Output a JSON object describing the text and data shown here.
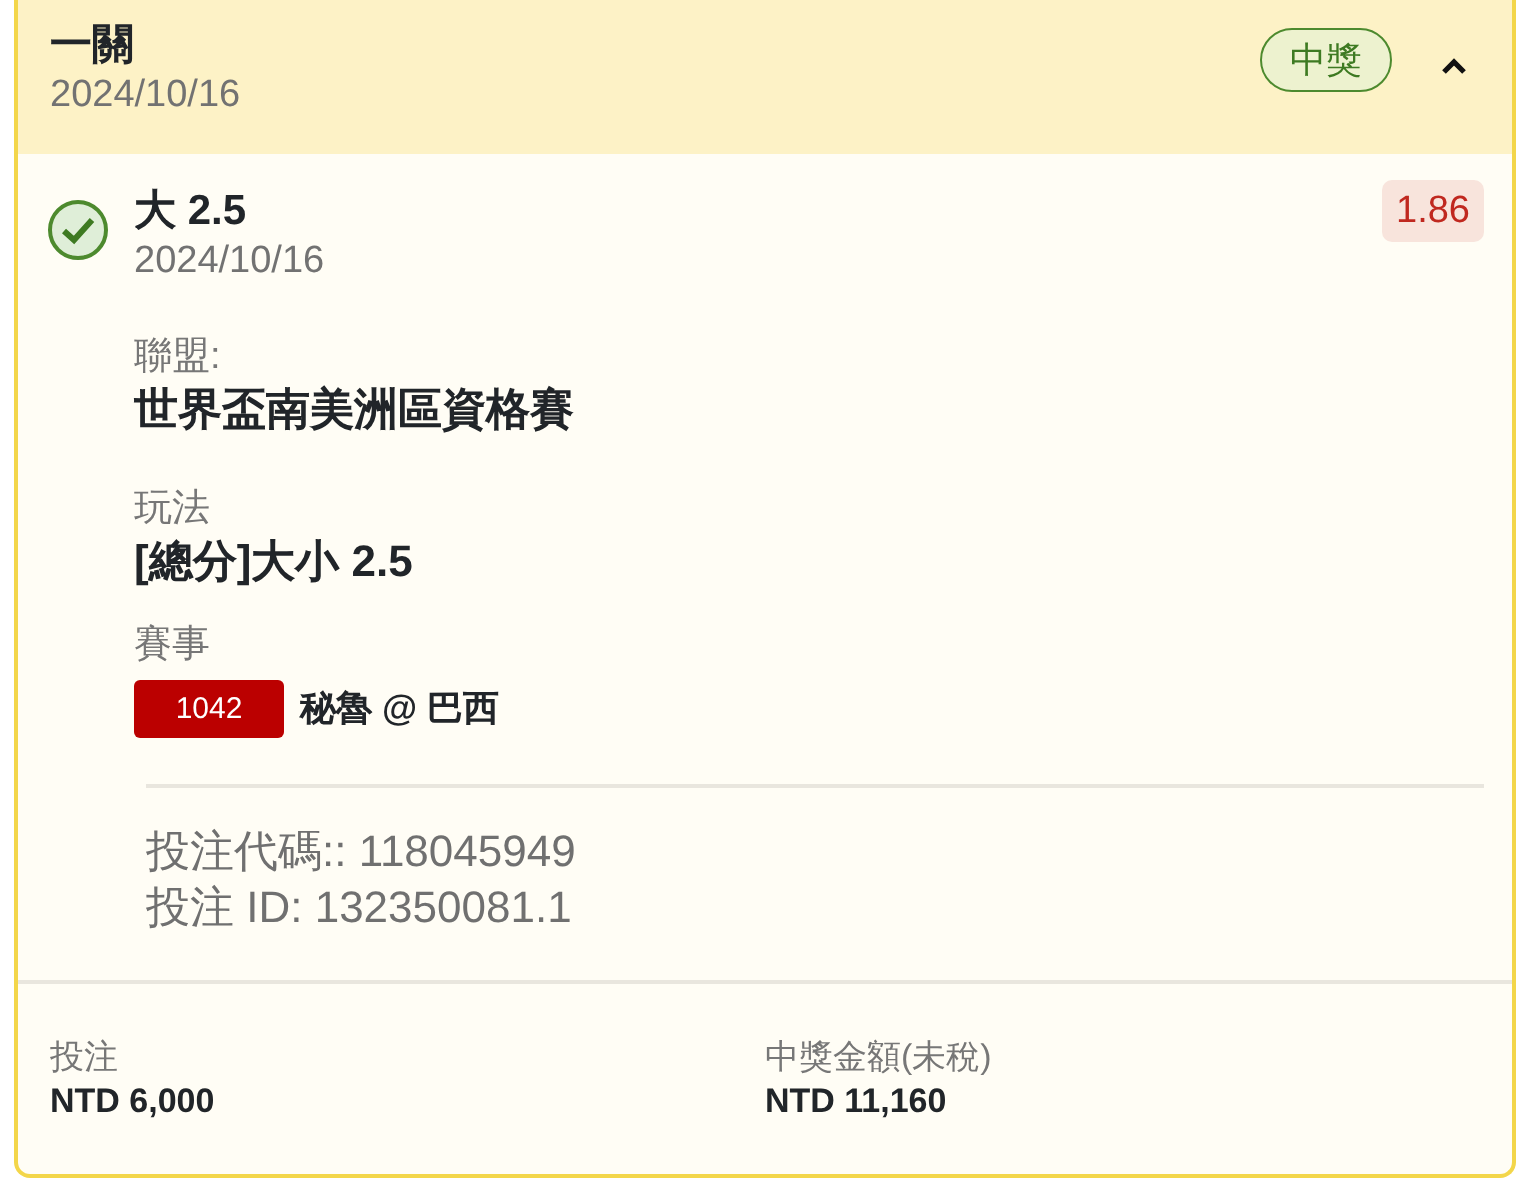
{
  "header": {
    "title": "一關",
    "date": "2024/10/16",
    "status": "中獎",
    "expanded": true
  },
  "selection": {
    "won": true,
    "pick": "大 2.5",
    "date": "2024/10/16",
    "odds": "1.86"
  },
  "details": [
    {
      "label": "聯盟:",
      "value": "世界盃南美洲區資格賽"
    },
    {
      "label": "玩法",
      "value": "[總分]大小 2.5"
    }
  ],
  "event": {
    "label": "賽事",
    "code": "1042",
    "match": "秘魯 @ 巴西"
  },
  "ids": [
    "投注代碼:: 118045949",
    "投注 ID: 132350081.1"
  ],
  "footer": [
    {
      "label": "投注",
      "value": "NTD 6,000"
    },
    {
      "label": "中獎金額(未稅)",
      "value": "NTD 11,160"
    }
  ]
}
